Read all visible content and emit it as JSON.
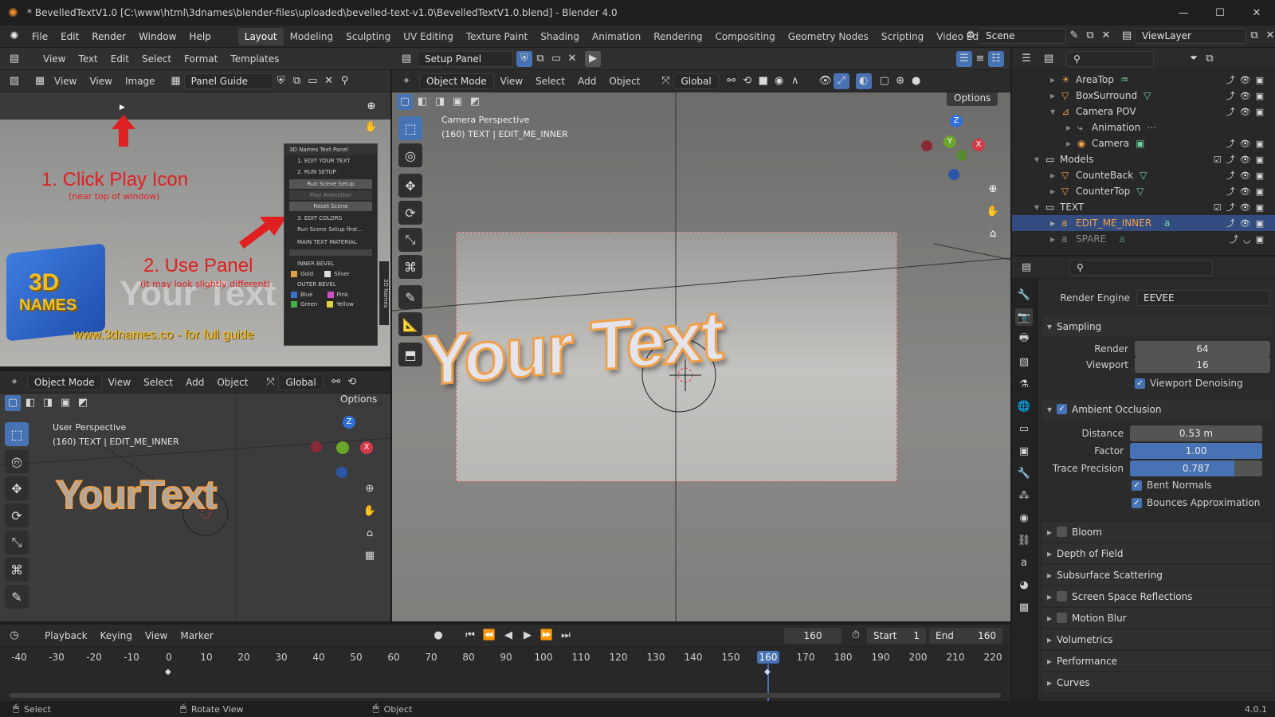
{
  "titlebar": {
    "title": "* BevelledTextV1.0 [C:\\www\\html\\3dnames\\blender-files\\uploaded\\bevelled-text-v1.0\\BevelledTextV1.0.blend] - Blender 4.0",
    "minimize": "—",
    "maximize": "☐",
    "close": "✕"
  },
  "menubar": {
    "items": [
      "File",
      "Edit",
      "Render",
      "Window",
      "Help"
    ],
    "workspaces": [
      "Layout",
      "Modeling",
      "Sculpting",
      "UV Editing",
      "Texture Paint",
      "Shading",
      "Animation",
      "Rendering",
      "Compositing",
      "Geometry Nodes",
      "Scripting",
      "Video Editing"
    ],
    "scene": "Scene",
    "viewlayer": "ViewLayer"
  },
  "texteditor": {
    "menus": [
      "View",
      "Text",
      "Edit",
      "Select",
      "Format",
      "Templates"
    ],
    "script_name": "Setup Panel"
  },
  "image_editor": {
    "menus": [
      "View",
      "View",
      "Image"
    ],
    "image_name": "Panel Guide",
    "guide": {
      "step1": "1. Click Play Icon",
      "step1_sub": "(near top of window)",
      "step2": "2. Use Panel",
      "step2_sub": "(it may look slightly different)",
      "site": "www.3dnames.co - for full guide",
      "logo1": "3D",
      "logo2": "NAMES",
      "panel_title": "3D Names Text Panel",
      "panel_items": [
        "1. EDIT YOUR TEXT",
        "2. RUN SETUP",
        "Run Scene Setup",
        "Play Animation",
        "Reset Scene",
        "3. EDIT COLORS",
        "Run Scene Setup first...",
        "MAIN TEXT MATERIAL",
        "INNER BEVEL",
        "Gold",
        "Silver",
        "OUTER BEVEL",
        "Blue",
        "Pink",
        "Green",
        "Yellow"
      ],
      "panel_tab": "3D Names",
      "bg_text": "Your Text"
    }
  },
  "viewport_small": {
    "mode": "Object Mode",
    "menus": [
      "View",
      "Select",
      "Add",
      "Object"
    ],
    "orientation": "Global",
    "options": "Options",
    "perspective": "User Perspective",
    "info": "(160) TEXT | EDIT_ME_INNER",
    "text3d": "YourText"
  },
  "viewport_main": {
    "mode": "Object Mode",
    "menus": [
      "View",
      "Select",
      "Add",
      "Object"
    ],
    "orientation": "Global",
    "options": "Options",
    "perspective": "Camera Perspective",
    "info": "(160) TEXT | EDIT_ME_INNER",
    "text3d": "Your Text"
  },
  "outliner": {
    "rows": [
      {
        "indent": 2,
        "icon": "☀",
        "label": "AreaTop",
        "extra": "♒"
      },
      {
        "indent": 2,
        "icon": "▽",
        "label": "BoxSurround",
        "extra": "▽"
      },
      {
        "indent": 2,
        "icon": "⊿",
        "label": "Camera POV",
        "extra": ""
      },
      {
        "indent": 3,
        "icon": "⤷",
        "label": "Animation",
        "extra": "⋯"
      },
      {
        "indent": 3,
        "icon": "◉",
        "label": "Camera",
        "extra": "▣"
      },
      {
        "indent": 1,
        "icon": "▭",
        "label": "Models",
        "extra": ""
      },
      {
        "indent": 2,
        "icon": "▽",
        "label": "CounteBack",
        "extra": "▽"
      },
      {
        "indent": 2,
        "icon": "▽",
        "label": "CounterTop",
        "extra": "▽"
      },
      {
        "indent": 1,
        "icon": "▭",
        "label": "TEXT",
        "extra": ""
      },
      {
        "indent": 2,
        "icon": "a",
        "label": "EDIT_ME_INNER",
        "extra": "a",
        "sel": true
      },
      {
        "indent": 2,
        "icon": "a",
        "label": "SPARE",
        "extra": "a"
      }
    ]
  },
  "properties": {
    "render_engine_label": "Render Engine",
    "render_engine": "EEVEE",
    "sampling": "Sampling",
    "render_label": "Render",
    "render_val": "64",
    "viewport_label": "Viewport",
    "viewport_val": "16",
    "denoise": "Viewport Denoising",
    "ao": "Ambient Occlusion",
    "distance_label": "Distance",
    "distance": "0.53 m",
    "factor_label": "Factor",
    "factor": "1.00",
    "trace_label": "Trace Precision",
    "trace": "0.787",
    "trace_fill": 0.787,
    "bent": "Bent Normals",
    "bounces": "Bounces Approximation",
    "sections": [
      "Bloom",
      "Depth of Field",
      "Subsurface Scattering",
      "Screen Space Reflections",
      "Motion Blur",
      "Volumetrics",
      "Performance",
      "Curves"
    ],
    "sections_chk": [
      true,
      false,
      false,
      true,
      true,
      false,
      false,
      false
    ]
  },
  "timeline": {
    "menus": [
      "Playback",
      "Keying",
      "View",
      "Marker"
    ],
    "current": "160",
    "start_label": "Start",
    "start": "1",
    "end_label": "End",
    "end": "160",
    "ticks": [
      "-40",
      "-30",
      "-20",
      "-10",
      "0",
      "10",
      "20",
      "30",
      "40",
      "50",
      "60",
      "70",
      "80",
      "90",
      "100",
      "110",
      "120",
      "130",
      "140",
      "150",
      "160",
      "170",
      "180",
      "190",
      "200",
      "210",
      "220"
    ]
  },
  "statusbar": {
    "select": "Select",
    "rotate": "Rotate View",
    "object": "Object",
    "version": "4.0.1"
  },
  "colors": {
    "accent": "#4772b3",
    "orange": "#f0a04a",
    "red_arrow": "#e02020"
  }
}
